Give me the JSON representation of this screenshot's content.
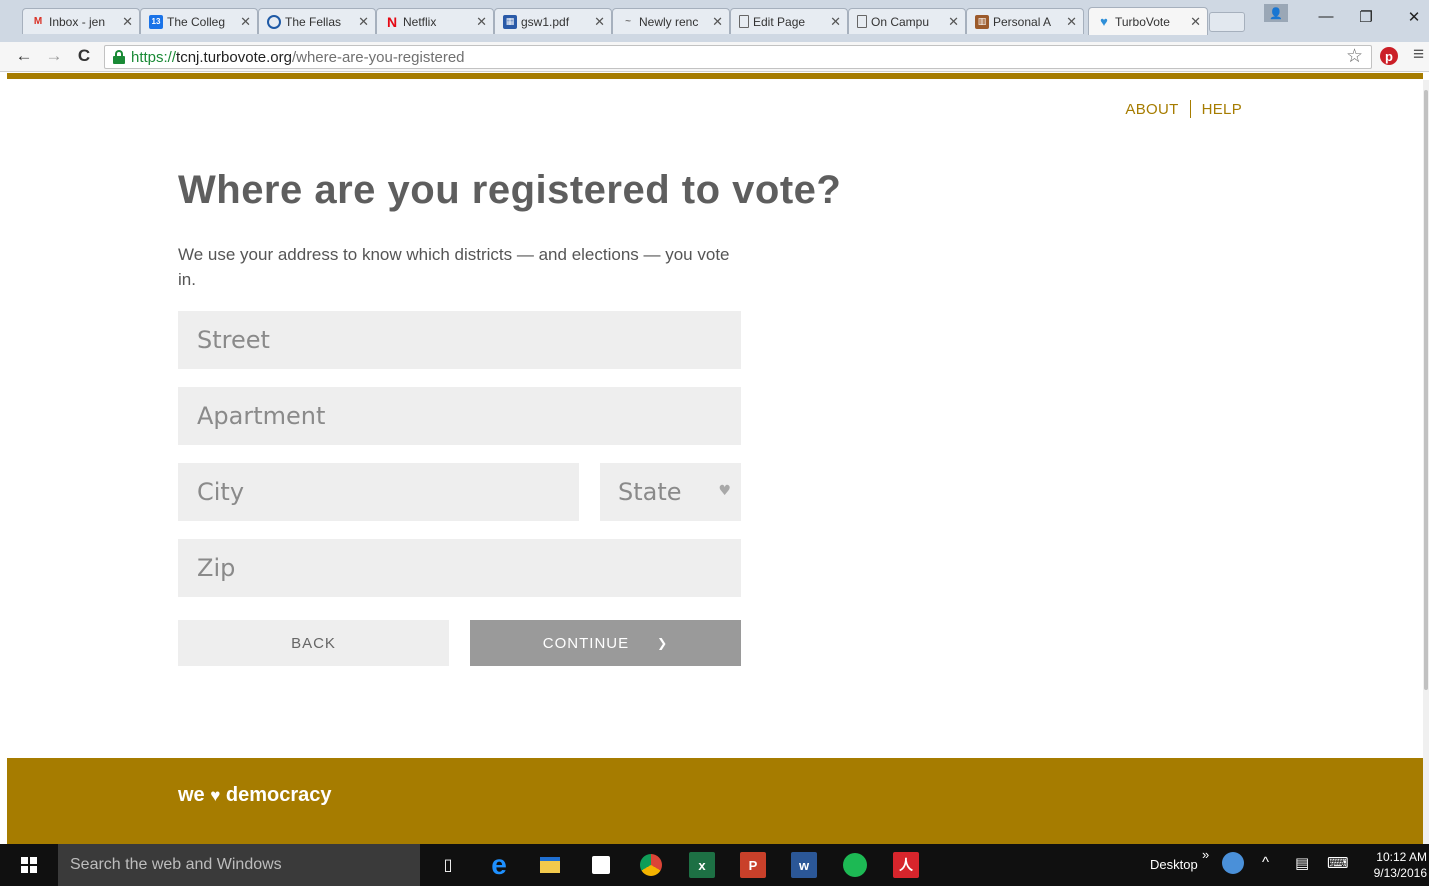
{
  "browser": {
    "tabs": [
      {
        "label": "Inbox - jen",
        "icon": "gmail-icon"
      },
      {
        "label": "The Colleg",
        "icon": "calendar-icon"
      },
      {
        "label": "The Fellas",
        "icon": "circle-icon"
      },
      {
        "label": "Netflix",
        "icon": "netflix-icon"
      },
      {
        "label": "gsw1.pdf",
        "icon": "sheet-icon"
      },
      {
        "label": "Newly renc",
        "icon": "page-icon"
      },
      {
        "label": "Edit Page",
        "icon": "document-icon"
      },
      {
        "label": "On Campu",
        "icon": "document-icon"
      },
      {
        "label": "Personal A",
        "icon": "book-icon"
      },
      {
        "label": "TurboVote",
        "icon": "heart-icon"
      }
    ],
    "active_tab_index": 9,
    "url": {
      "scheme": "https://",
      "host": "tcnj.turbovote.org",
      "path": "/where-are-you-registered"
    }
  },
  "nav": {
    "about": "ABOUT",
    "help": "HELP"
  },
  "main": {
    "title": "Where are you registered to vote?",
    "intro": "We use your address to know which districts — and elections — you vote in.",
    "fields": {
      "street_placeholder": "Street",
      "apartment_placeholder": "Apartment",
      "city_placeholder": "City",
      "state_selected": "State",
      "zip_placeholder": "Zip"
    },
    "back_label": "BACK",
    "continue_label": "CONTINUE"
  },
  "footer": {
    "brand_we": "we",
    "brand_democracy": "democracy"
  },
  "taskbar": {
    "search_placeholder": "Search the web and Windows",
    "desktop_label": "Desktop",
    "time": "10:12 AM",
    "date": "9/13/2016"
  },
  "colors": {
    "brand_gold": "#a67c00",
    "input_bg": "#eeeeee",
    "continue_bg": "#9a9a9a"
  }
}
